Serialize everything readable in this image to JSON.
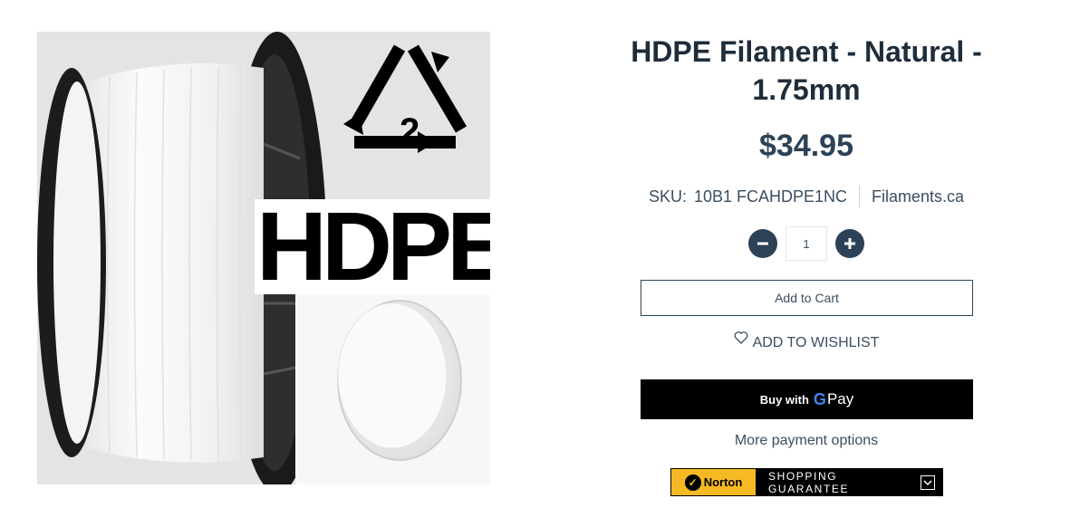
{
  "product": {
    "title": "HDPE Filament - Natural - 1.75mm",
    "price": "$34.95",
    "sku_label": "SKU:",
    "sku_value": "10B1 FCAHDPE1NC",
    "vendor": "Filaments.ca",
    "image": {
      "overlay_text": "HDPE",
      "recycle_code": "2"
    }
  },
  "quantity": {
    "value": "1",
    "decrease_icon": "minus-icon",
    "increase_icon": "plus-icon"
  },
  "actions": {
    "add_to_cart": "Add to Cart",
    "wishlist": "ADD TO WISHLIST",
    "wishlist_icon": "heart-icon",
    "gpay_buy": "Buy with",
    "gpay_g": "G",
    "gpay_pay": "Pay",
    "more_payment": "More payment options"
  },
  "norton": {
    "brand": "Norton",
    "label": "SHOPPING GUARANTEE",
    "icon": "chevron-down-icon"
  },
  "colors": {
    "heading": "#1f2d3a",
    "accent": "#2c4256",
    "norton_yellow": "#f5b923",
    "gpay_bg": "#000000"
  }
}
